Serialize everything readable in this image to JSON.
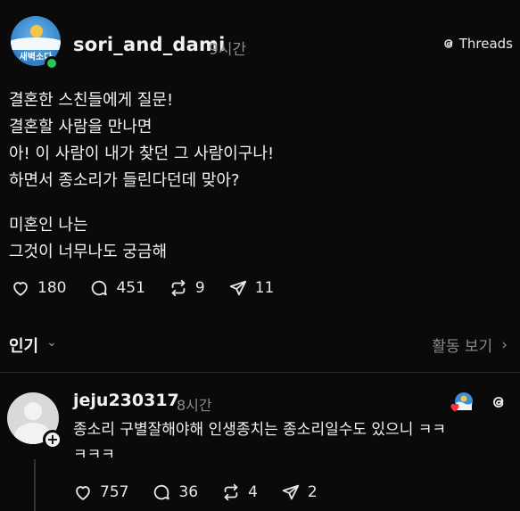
{
  "post": {
    "username": "sori_and_dami",
    "time": "9시간",
    "avatar_text": "새벽소다",
    "threads_label": "Threads",
    "paragraphs": [
      [
        "결혼한 스친들에게 질문!",
        "결혼할 사람을 만나면",
        "아! 이 사람이 내가 찾던 그 사람이구나!",
        "하면서 종소리가 들린다던데 맞아?"
      ],
      [
        "미혼인 나는",
        "그것이 너무나도 궁금해"
      ]
    ],
    "stats": {
      "likes": "180",
      "comments": "451",
      "reposts": "9",
      "shares": "11"
    }
  },
  "sort_bar": {
    "label": "인기",
    "chevron": "⌄",
    "activity_label": "활동 보기",
    "activity_chevron": "›"
  },
  "reply": {
    "username": "jeju230317",
    "time": "8시간",
    "follow_symbol": "+",
    "text_lines": [
      "종소리 구별잘해야해 인생종치는 종소리일수도 있으니 ㅋㅋ",
      "ㅋㅋㅋ"
    ],
    "stats": {
      "likes": "757",
      "comments": "36",
      "reposts": "4",
      "shares": "2"
    }
  },
  "icons": {
    "like": "heart-icon",
    "comment": "comment-bubble-icon",
    "repost": "repost-icon",
    "share": "send-icon",
    "threads": "threads-logo-icon",
    "online": "online-status-icon",
    "follow": "follow-plus-icon"
  },
  "colors": {
    "background": "#0a0a0a",
    "text": "#f2f2f2",
    "muted": "#8a8a8a",
    "online": "#2ec25b"
  }
}
